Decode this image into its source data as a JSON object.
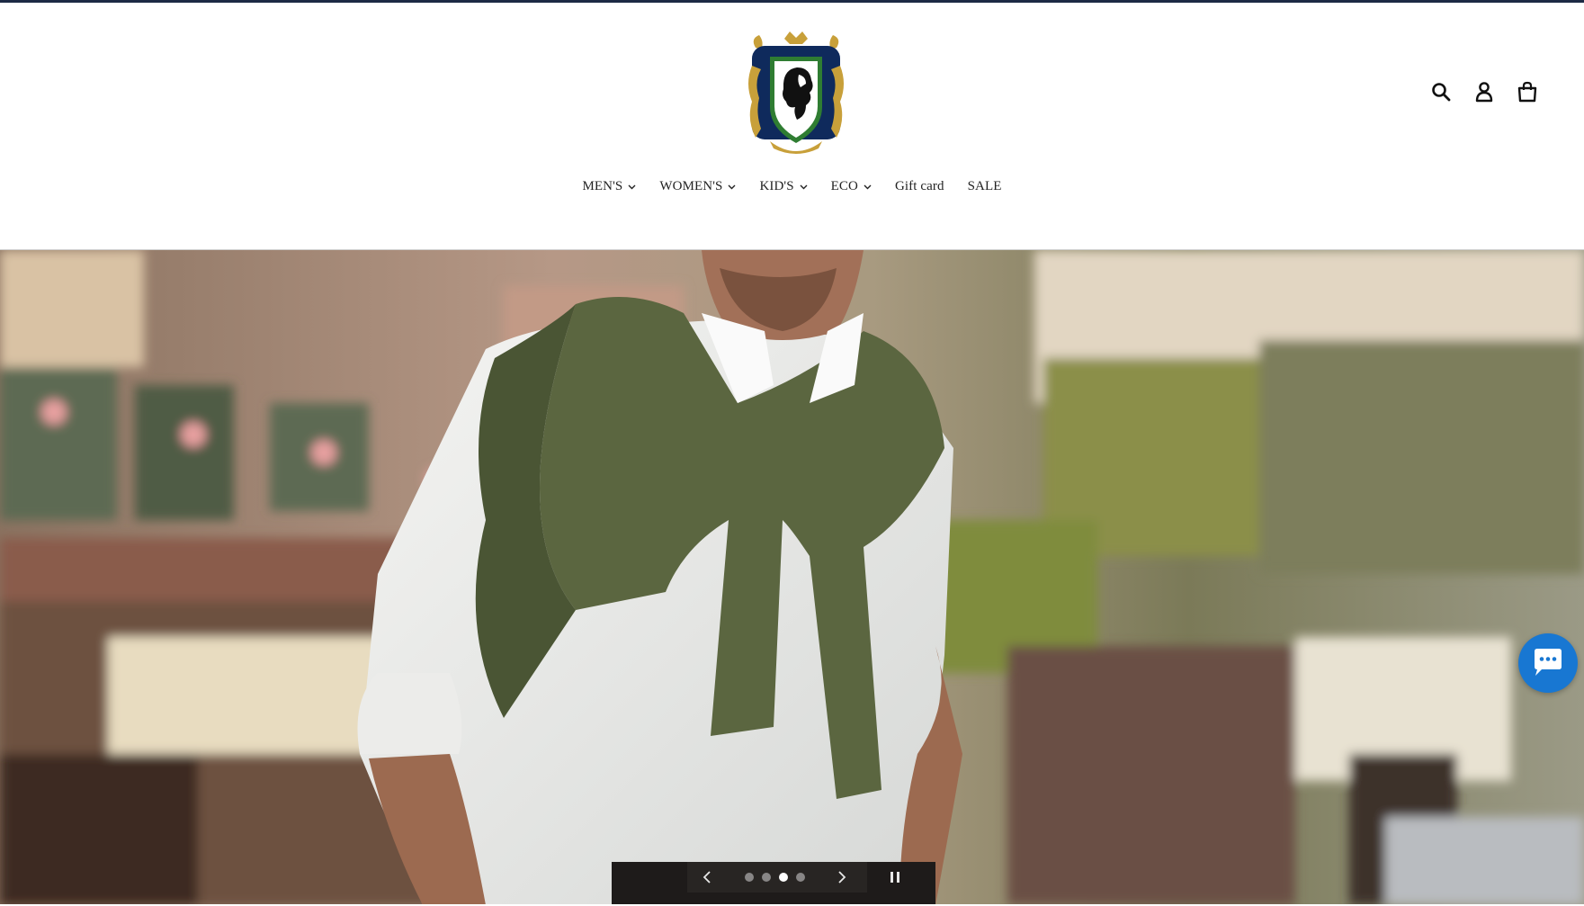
{
  "nav": {
    "items": [
      {
        "label": "MEN'S",
        "dropdown": true
      },
      {
        "label": "WOMEN'S",
        "dropdown": true
      },
      {
        "label": "KID'S",
        "dropdown": true
      },
      {
        "label": "ECO",
        "dropdown": true
      },
      {
        "label": "Gift card",
        "dropdown": false
      },
      {
        "label": "SALE",
        "dropdown": false
      }
    ]
  },
  "header_icons": [
    "search-icon",
    "account-icon",
    "cart-icon"
  ],
  "slideshow": {
    "slide_count": 4,
    "active_slide": 3
  },
  "colors": {
    "top_rule": "#1c2a44",
    "chat_button": "#1877d2",
    "logo_navy": "#0f2a5c",
    "logo_gold": "#c8a03a",
    "logo_green": "#2f7d32"
  }
}
